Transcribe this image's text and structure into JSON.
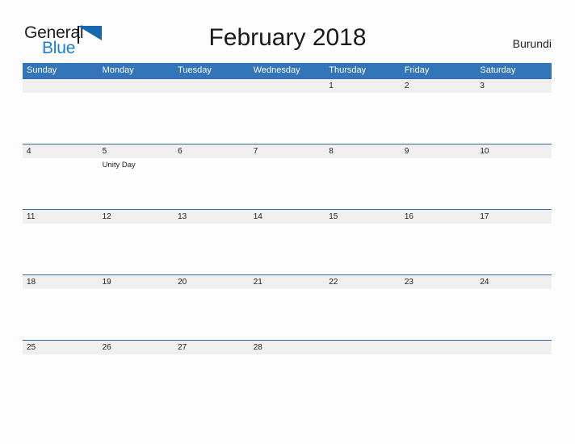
{
  "logo": {
    "part1": "General",
    "part2": "Blue",
    "flag_icon": "blue-triangle-flag-icon",
    "color_text": "#231f20",
    "color_blue": "#1c7fd4"
  },
  "header": {
    "title": "February 2018",
    "country": "Burundi"
  },
  "theme": {
    "header_blue": "#3275b8",
    "rule_blue": "#2d6ca8",
    "band_gray": "#efefef",
    "page_bg": "#fdfdfd"
  },
  "calendar": {
    "weekdays": [
      "Sunday",
      "Monday",
      "Tuesday",
      "Wednesday",
      "Thursday",
      "Friday",
      "Saturday"
    ],
    "weeks": [
      {
        "days": [
          {
            "date": "",
            "event": ""
          },
          {
            "date": "",
            "event": ""
          },
          {
            "date": "",
            "event": ""
          },
          {
            "date": "",
            "event": ""
          },
          {
            "date": "1",
            "event": ""
          },
          {
            "date": "2",
            "event": ""
          },
          {
            "date": "3",
            "event": ""
          }
        ]
      },
      {
        "days": [
          {
            "date": "4",
            "event": ""
          },
          {
            "date": "5",
            "event": "Unity Day"
          },
          {
            "date": "6",
            "event": ""
          },
          {
            "date": "7",
            "event": ""
          },
          {
            "date": "8",
            "event": ""
          },
          {
            "date": "9",
            "event": ""
          },
          {
            "date": "10",
            "event": ""
          }
        ]
      },
      {
        "days": [
          {
            "date": "11",
            "event": ""
          },
          {
            "date": "12",
            "event": ""
          },
          {
            "date": "13",
            "event": ""
          },
          {
            "date": "14",
            "event": ""
          },
          {
            "date": "15",
            "event": ""
          },
          {
            "date": "16",
            "event": ""
          },
          {
            "date": "17",
            "event": ""
          }
        ]
      },
      {
        "days": [
          {
            "date": "18",
            "event": ""
          },
          {
            "date": "19",
            "event": ""
          },
          {
            "date": "20",
            "event": ""
          },
          {
            "date": "21",
            "event": ""
          },
          {
            "date": "22",
            "event": ""
          },
          {
            "date": "23",
            "event": ""
          },
          {
            "date": "24",
            "event": ""
          }
        ]
      },
      {
        "days": [
          {
            "date": "25",
            "event": ""
          },
          {
            "date": "26",
            "event": ""
          },
          {
            "date": "27",
            "event": ""
          },
          {
            "date": "28",
            "event": ""
          },
          {
            "date": "",
            "event": ""
          },
          {
            "date": "",
            "event": ""
          },
          {
            "date": "",
            "event": ""
          }
        ]
      }
    ]
  }
}
